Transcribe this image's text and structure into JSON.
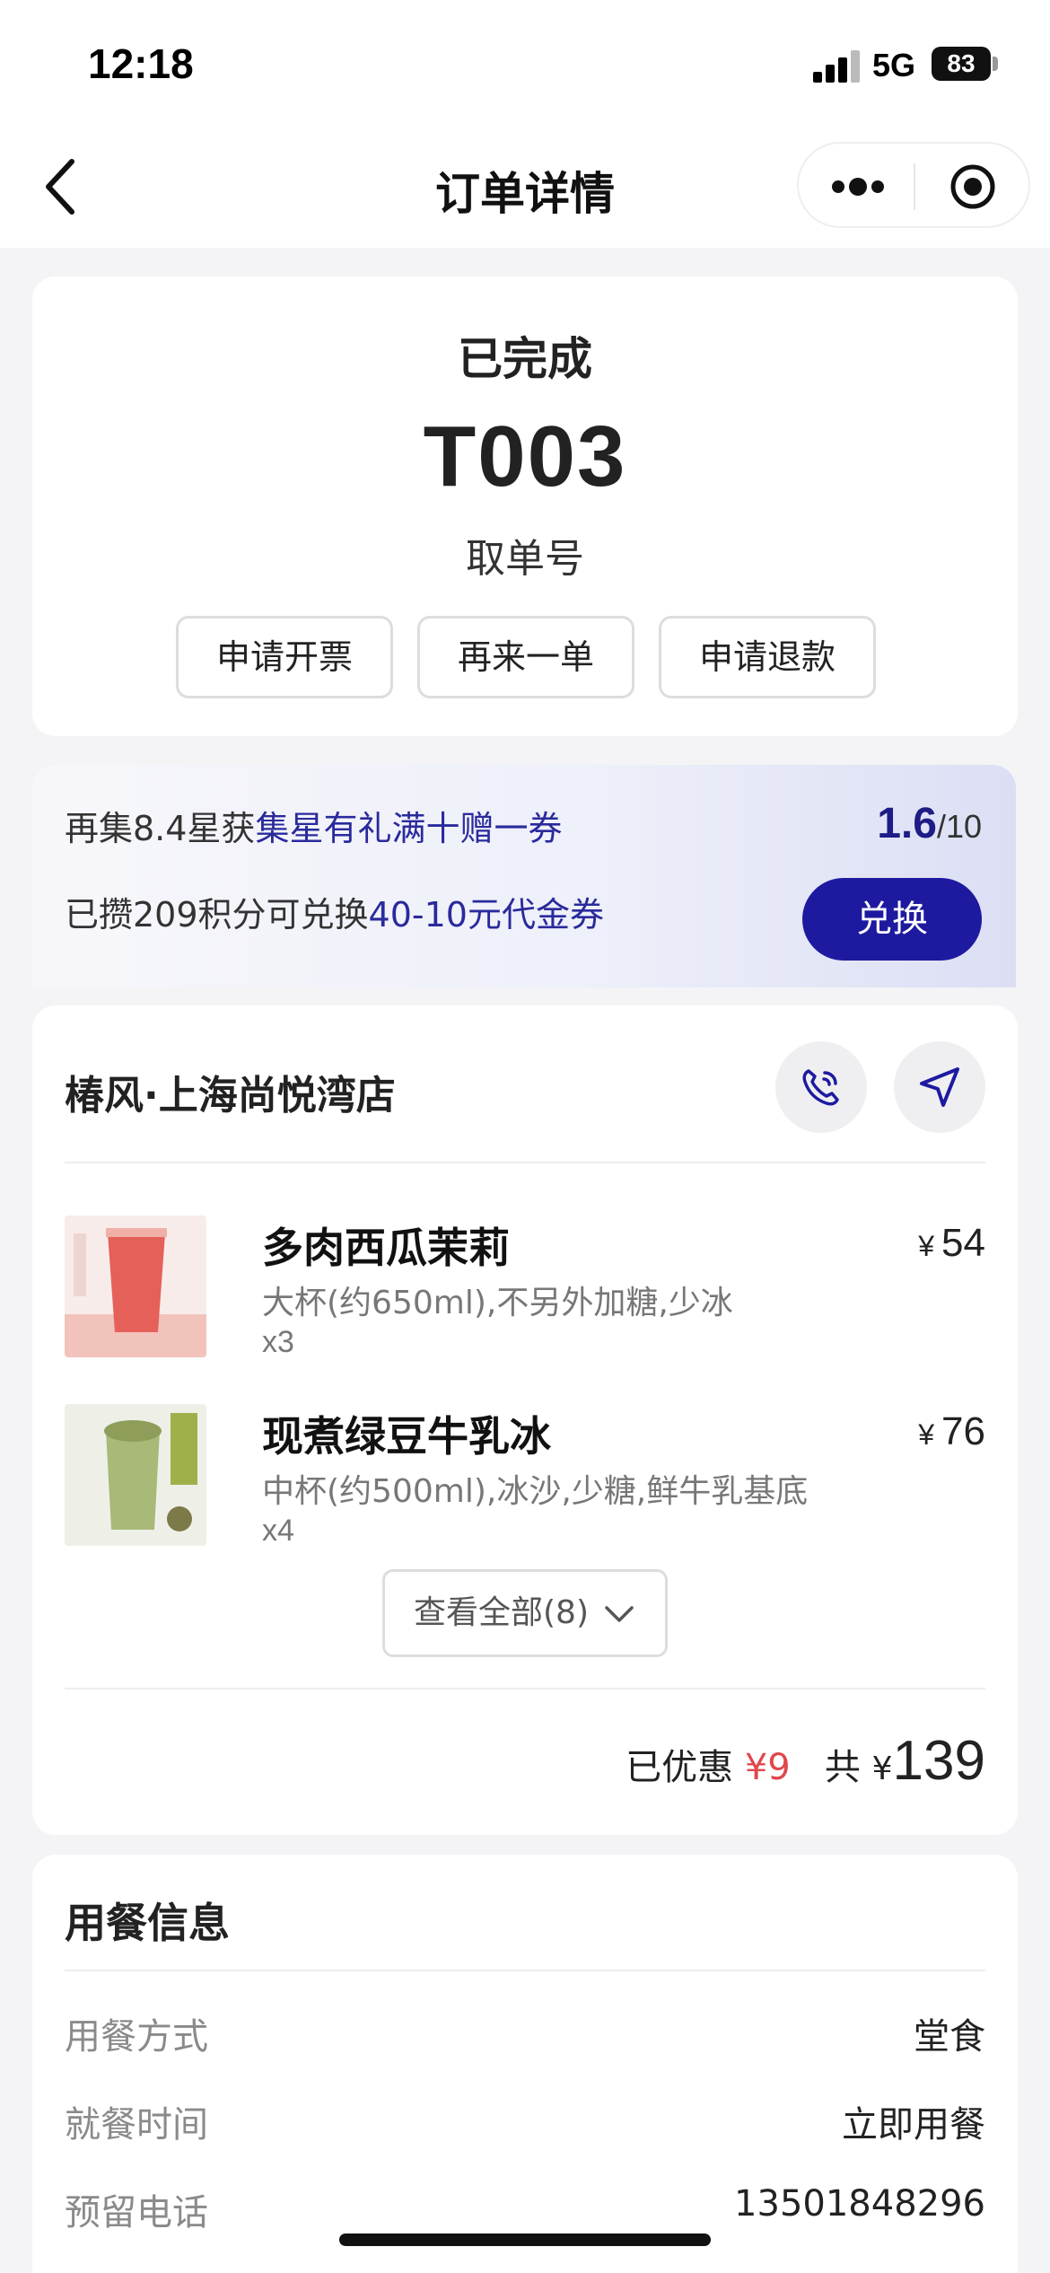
{
  "status_bar": {
    "time": "12:18",
    "network": "5G",
    "battery": "83"
  },
  "nav": {
    "title": "订单详情"
  },
  "order": {
    "status": "已完成",
    "pickup_number": "T003",
    "pickup_label": "取单号",
    "actions": [
      "申请开票",
      "再来一单",
      "申请退款"
    ]
  },
  "promo": {
    "line1_prefix": "再集8.4星获",
    "line1_highlight": "集星有礼满十赠一券",
    "progress_current": "1.6",
    "progress_total": "/10",
    "line2_prefix": "已攒209积分可兑换",
    "line2_highlight": "40-10元代金券",
    "redeem_label": "兑换"
  },
  "store": {
    "name": "椿风·上海尚悦湾店",
    "items": [
      {
        "name": "多肉西瓜茉莉",
        "spec": "大杯(约650ml),不另外加糖,少冰",
        "qty": "x3",
        "currency": "¥",
        "price": "54"
      },
      {
        "name": "现煮绿豆牛乳冰",
        "spec": "中杯(约500ml),冰沙,少糖,鲜牛乳基底",
        "qty": "x4",
        "currency": "¥",
        "price": "76"
      }
    ],
    "view_all_label": "查看全部(8)",
    "discount_label": "已优惠",
    "discount_value": "¥9",
    "total_label": "共",
    "total_currency": "¥",
    "total_value": "139"
  },
  "dining": {
    "title": "用餐信息",
    "rows": [
      {
        "label": "用餐方式",
        "value": "堂食"
      },
      {
        "label": "就餐时间",
        "value": "立即用餐"
      },
      {
        "label": "预留电话",
        "value": "13501848296"
      }
    ]
  },
  "colors": {
    "accent": "#1e1aa0",
    "discount_red": "#e0474c"
  }
}
